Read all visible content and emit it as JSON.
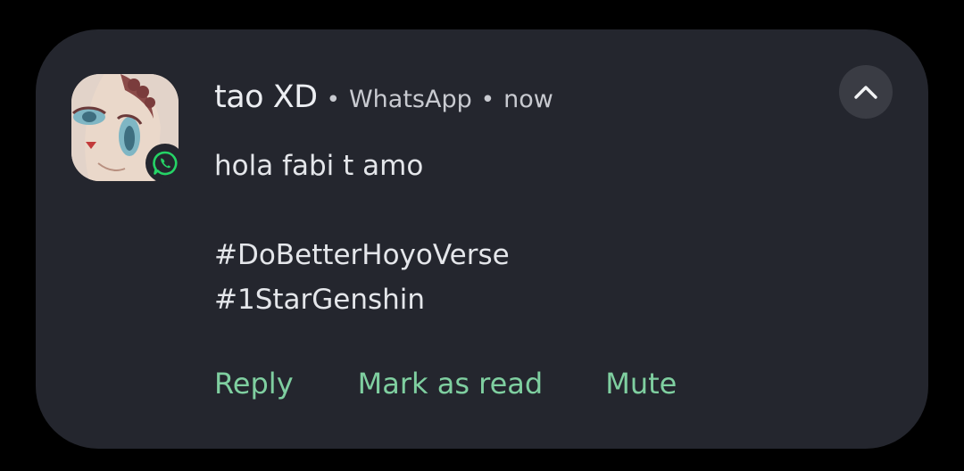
{
  "notification": {
    "sender": "tao XD",
    "separator": "•",
    "app_name": "WhatsApp",
    "time": "now",
    "message_lines": [
      "hola fabi t amo",
      "",
      "#DoBetterHoyoVerse",
      "#1StarGenshin"
    ],
    "avatar_icon": "contact-photo",
    "app_icon": "whatsapp-icon",
    "collapse_icon": "chevron-up-icon",
    "actions": {
      "reply": "Reply",
      "mark_read": "Mark as read",
      "mute": "Mute"
    }
  },
  "colors": {
    "background": "#000000",
    "card": "#24262e",
    "action_text": "#7fcfa0",
    "whatsapp_green": "#25d366",
    "collapse_button": "#3a3c44"
  }
}
